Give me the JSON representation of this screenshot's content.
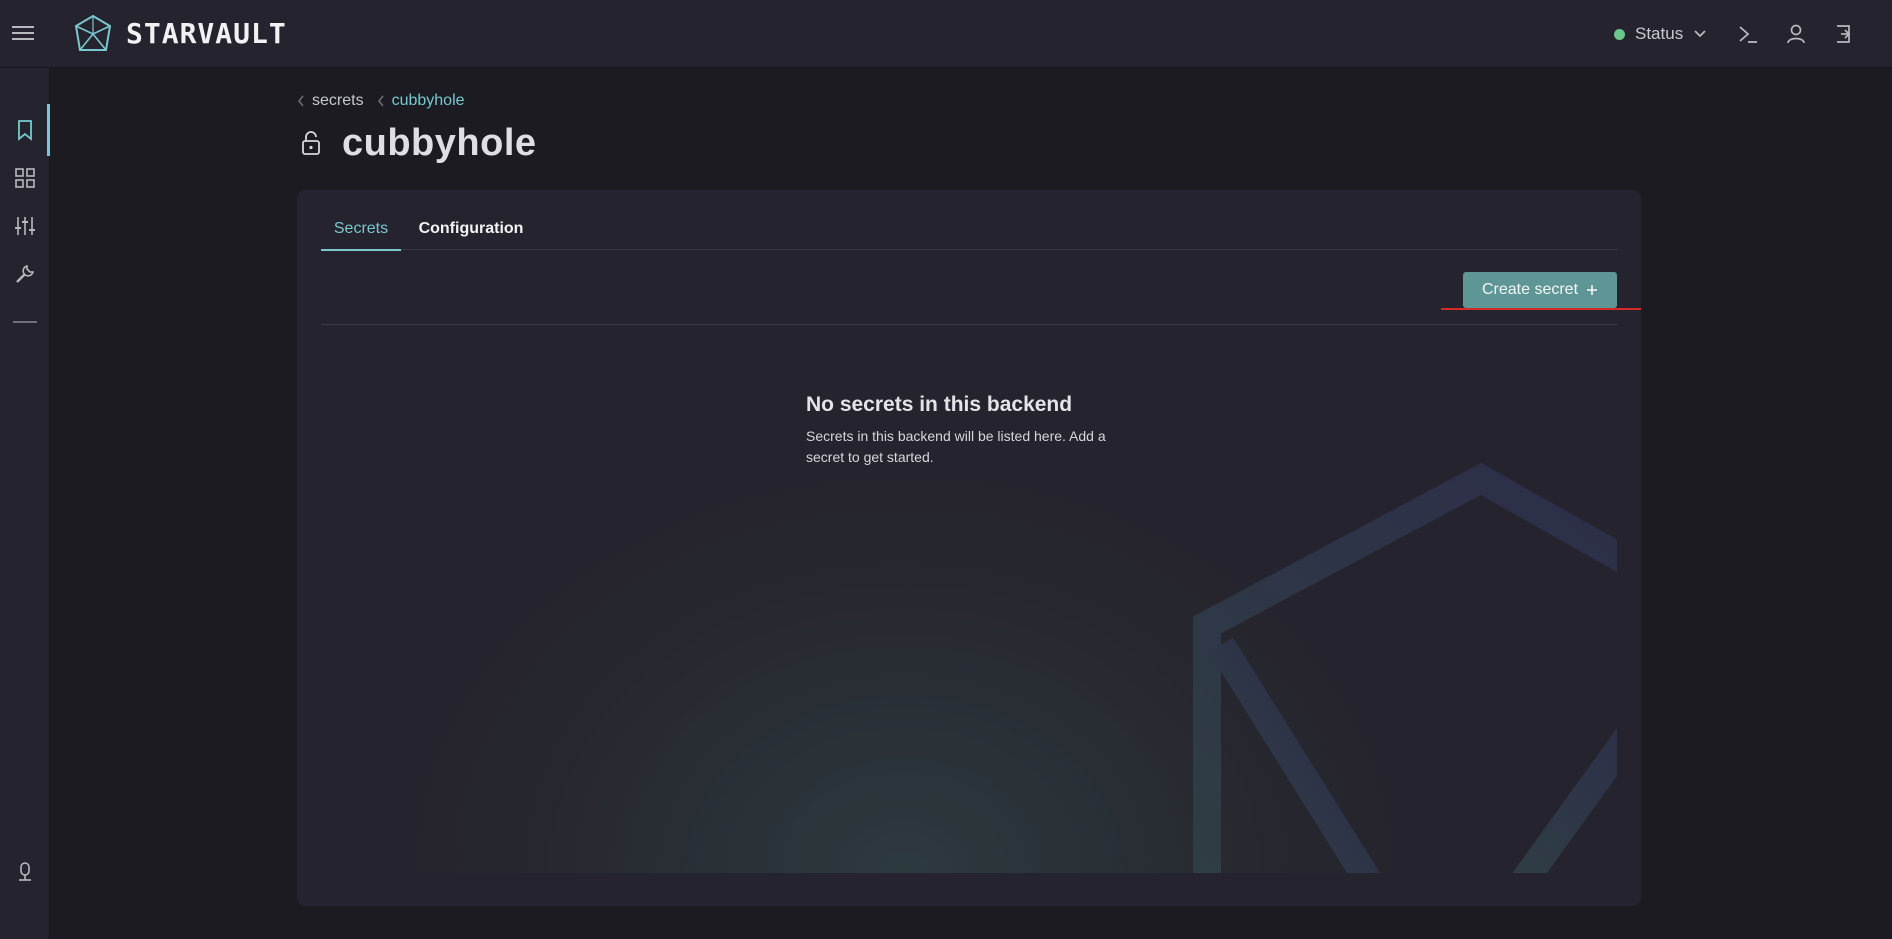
{
  "app": {
    "brand": "STARVAULT",
    "status_label": "Status",
    "status_color": "#6cc58a",
    "accent_color": "#79c8cf"
  },
  "topbar": {
    "icons": [
      "menu-icon",
      "terminal-icon",
      "user-icon",
      "logout-icon"
    ]
  },
  "sidebar": {
    "items": [
      {
        "icon": "bookmark-icon",
        "active": true
      },
      {
        "icon": "dashboard-grid-icon",
        "active": false
      },
      {
        "icon": "sliders-icon",
        "active": false
      },
      {
        "icon": "wrench-icon",
        "active": false
      },
      {
        "icon": "collapse-line-icon",
        "active": false
      }
    ],
    "bottom_icon": "microphone-icon"
  },
  "breadcrumb": {
    "items": [
      "secrets",
      "cubbyhole"
    ]
  },
  "page": {
    "title": "cubbyhole",
    "title_icon": "lock-open-icon"
  },
  "tabs": [
    {
      "label": "Secrets",
      "active": true
    },
    {
      "label": "Configuration",
      "active": false
    }
  ],
  "toolbar": {
    "create_label": "Create secret",
    "create_icon": "plus-icon"
  },
  "empty_state": {
    "title": "No secrets in this backend",
    "description": "Secrets in this backend will be listed here. Add a secret to get started."
  }
}
